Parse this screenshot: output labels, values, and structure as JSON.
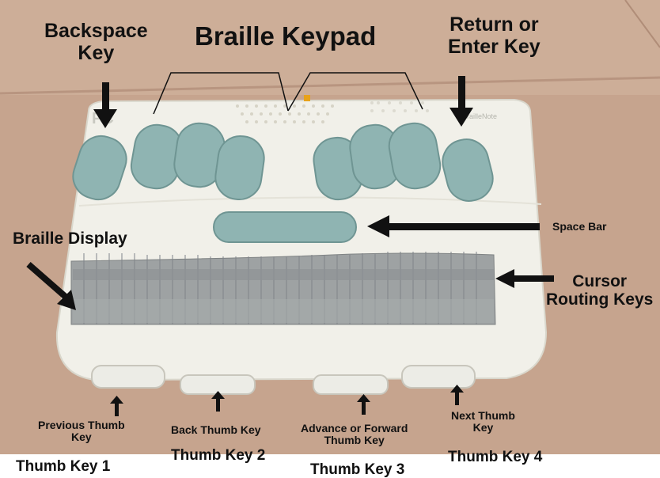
{
  "title": "Braille Keypad",
  "labels": {
    "backspace": "Backspace\nKey",
    "return": "Return or\nEnter Key",
    "space_bar": "Space Bar",
    "braille_display": "Braille Display",
    "cursor_routing": "Cursor\nRouting Keys",
    "previous_thumb": "Previous Thumb\nKey",
    "back_thumb": "Back Thumb Key",
    "advance_thumb": "Advance or Forward\nThumb Key",
    "next_thumb": "Next Thumb\nKey",
    "thumb1": "Thumb Key 1",
    "thumb2": "Thumb Key 2",
    "thumb3": "Thumb Key 3",
    "thumb4": "Thumb Key 4"
  },
  "colors": {
    "background": "#c9a892",
    "device_body": "#f1f0e9",
    "keys": "#8fb4b2",
    "display": "#9ea2a3"
  }
}
